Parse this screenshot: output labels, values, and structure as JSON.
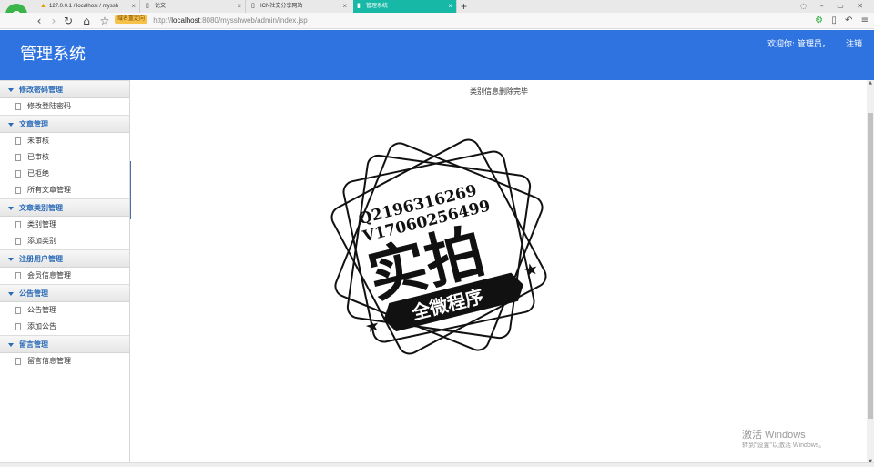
{
  "browser": {
    "tabs": [
      {
        "label": "127.0.0.1 / localhost / myssh",
        "icon": "warning-icon"
      },
      {
        "label": "论文",
        "icon": "document-icon"
      },
      {
        "label": "ICN社交分享网站",
        "icon": "document-icon"
      },
      {
        "label": "管理系统",
        "icon": "document-icon",
        "active": true
      }
    ],
    "new_tab": "+",
    "address": {
      "badge": "域名重定向",
      "scheme": "http://",
      "host": "localhost",
      "rest": ":8080/mysshweb/admin/index.jsp"
    }
  },
  "header": {
    "title": "管理系统",
    "welcome": "欢迎你: 管理员，",
    "logout": "注销",
    "bg_color": "#2f73e1"
  },
  "sidebar": {
    "groups": [
      {
        "title": "修改密码管理",
        "items": [
          "修改登陆密码"
        ]
      },
      {
        "title": "文章管理",
        "items": [
          "未审核",
          "已审核",
          "已拒绝",
          "所有文章管理"
        ]
      },
      {
        "title": "文章类别管理",
        "items": [
          "类别管理",
          "添加类别"
        ]
      },
      {
        "title": "注册用户管理",
        "items": [
          "会员信息管理"
        ]
      },
      {
        "title": "公告管理",
        "items": [
          "公告管理",
          "添加公告"
        ]
      },
      {
        "title": "留言管理",
        "items": [
          "留言信息管理"
        ]
      }
    ]
  },
  "main": {
    "message": "类别信息删除完毕",
    "stamp": {
      "line1": "Q2196316269",
      "line2": "V17060256499",
      "big": "实拍",
      "banner": "全微程序"
    }
  },
  "watermark": {
    "line1": "激活 Windows",
    "line2": "转到\"设置\"以激活 Windows。"
  }
}
